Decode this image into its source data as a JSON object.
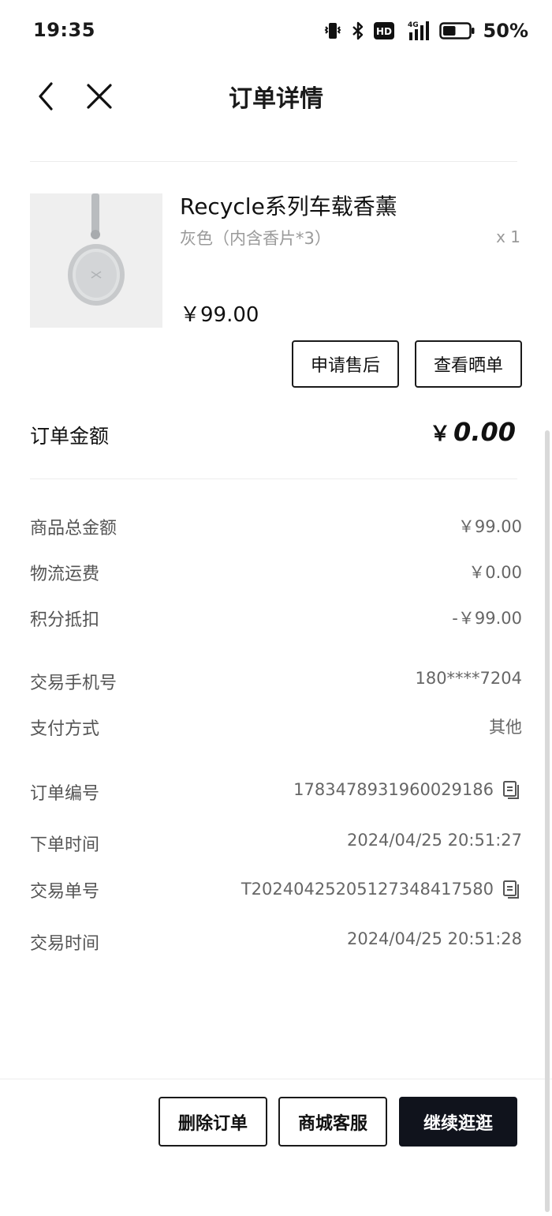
{
  "status_bar": {
    "time": "19:35",
    "hd_label": "HD",
    "network_label": "4G",
    "battery_percent": "50%",
    "battery_level": 0.5,
    "icons": [
      "vibrate-icon",
      "bluetooth-icon",
      "hd-icon",
      "signal-icon",
      "battery-icon"
    ]
  },
  "nav": {
    "title": "订单详情",
    "back_icon": "chevron-left-icon",
    "close_icon": "close-icon"
  },
  "product": {
    "name": "Recycle系列车载香薰",
    "variant": "灰色（内含香片*3）",
    "quantity": "x 1",
    "price": "￥99.00",
    "actions": {
      "after_sale": "申请售后",
      "view_review": "查看晒单"
    }
  },
  "order_amount": {
    "label": "订单金额",
    "currency": "￥",
    "value": "0.00"
  },
  "details": [
    {
      "label": "商品总金额",
      "value": "￥99.00",
      "copyable": false
    },
    {
      "label": "物流运费",
      "value": "￥0.00",
      "copyable": false
    },
    {
      "label": "积分抵扣",
      "value": "-￥99.00",
      "copyable": false
    },
    {
      "label": "交易手机号",
      "value": "180****7204",
      "copyable": false
    },
    {
      "label": "支付方式",
      "value": "其他",
      "copyable": false
    },
    {
      "label": "订单编号",
      "value": "1783478931960029186",
      "copyable": true
    },
    {
      "label": "下单时间",
      "value": "2024/04/25 20:51:27",
      "copyable": false
    },
    {
      "label": "交易单号",
      "value": "T20240425205127348417580",
      "copyable": true
    },
    {
      "label": "交易时间",
      "value": "2024/04/25 20:51:28",
      "copyable": false
    }
  ],
  "bottom_actions": {
    "delete_order": "删除订单",
    "customer_service": "商城客服",
    "continue_shopping": "继续逛逛"
  },
  "colors": {
    "primary_button": "#10131c",
    "muted_text": "#9a9a9a",
    "divider": "#ececec"
  }
}
